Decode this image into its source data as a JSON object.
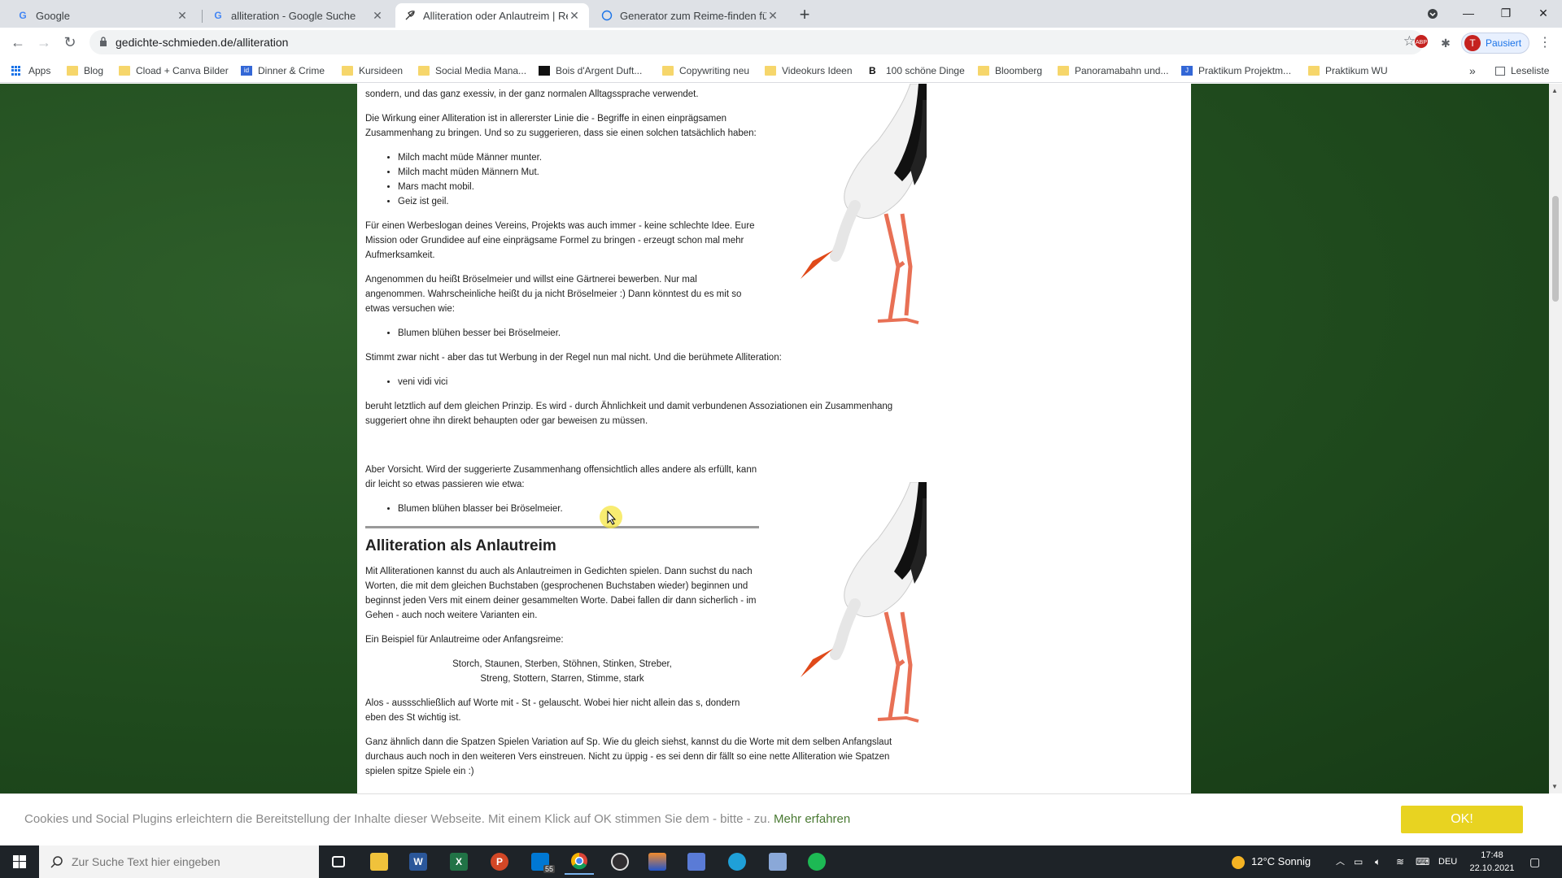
{
  "browser": {
    "tabs": [
      {
        "title": "Google",
        "favicon": "G"
      },
      {
        "title": "alliteration - Google Suche",
        "favicon": "G"
      },
      {
        "title": "Alliteration oder Anlautreim | Re",
        "favicon": "feather",
        "active": true
      },
      {
        "title": "Generator zum Reime-finden für",
        "favicon": "circle"
      }
    ],
    "url": "gedichte-schmieden.de/alliteration",
    "profile_label": "Pausiert",
    "profile_initial": "T",
    "extension_badge": "2"
  },
  "bookmarks": {
    "apps": "Apps",
    "items": [
      "Blog",
      "Cload + Canva Bilder",
      "Dinner & Crime",
      "Kursideen",
      "Social Media Mana...",
      "Bois d'Argent Duft...",
      "Copywriting neu",
      "Videokurs Ideen",
      "100 schöne Dinge",
      "Bloomberg",
      "Panoramabahn und...",
      "Praktikum Projektm...",
      "Praktikum WU"
    ],
    "more": "»",
    "reading_list": "Leseliste"
  },
  "article": {
    "p0": "sondern, und das ganz exessiv, in der ganz normalen Alltagssprache verwendet.",
    "p1": "Die Wirkung einer Alliteration ist in allererster Linie die - Begriffe in einen einprägsamen Zusammenhang zu bringen. Und so zu suggerieren, dass sie einen solchen tatsächlich haben:",
    "list1": [
      "Milch macht müde Männer munter.",
      "Milch macht müden Männern Mut.",
      "Mars macht mobil.",
      "Geiz ist geil."
    ],
    "p2": "Für einen Werbeslogan deines Vereins, Projekts was auch immer - keine schlechte Idee. Eure Mission oder Grundidee auf eine einprägsame Formel zu bringen - erzeugt schon mal mehr Aufmerksamkeit.",
    "p3": "Angenommen du heißt Bröselmeier und willst eine Gärtnerei bewerben. Nur mal angenommen. Wahrscheinliche heißt du ja nicht Bröselmeier :) Dann könntest du es mit so etwas versuchen wie:",
    "list2": [
      "Blumen blühen besser bei Bröselmeier."
    ],
    "p4": "Stimmt zwar nicht - aber das tut Werbung in der Regel nun mal nicht. Und die berühmete Alliteration:",
    "list3": [
      "veni vidi vici"
    ],
    "p5": "beruht letztlich auf dem gleichen Prinzip. Es wird - durch Ähnlichkeit und damit verbundenen Assoziationen ein Zusammenhang suggeriert ohne ihn direkt behaupten oder gar beweisen zu müssen.",
    "p6": "Aber Vorsicht. Wird der suggerierte Zusammenhang offensichtlich alles andere als erfüllt, kann dir leicht so etwas passieren wie etwa:",
    "list4": [
      "Blumen blühen blasser bei Bröselmeier."
    ],
    "heading": "Alliteration als Anlautreim",
    "p7": "Mit Alliterationen kannst du auch als Anlautreimen in Gedichten spielen. Dann suchst du nach Worten, die mit dem gleichen Buchstaben (gesprochenen Buchstaben wieder) beginnen und beginnst jeden Vers mit einem deiner gesammelten Worte. Dabei fallen dir dann sicherlich - im Gehen - auch noch weitere Varianten ein.",
    "p8": "Ein Beispiel für Anlautreime oder Anfangsreime:",
    "poem1": "Storch, Staunen, Sterben, Stöhnen, Stinken, Streber,",
    "poem2": "Streng, Stottern, Starren, Stimme, stark",
    "p9": "Alos - aussschließlich auf Worte mit - St - gelauscht. Wobei hier nicht allein das s, dondern eben des St wichtig ist.",
    "p10": "Ganz ähnlich dann die Spatzen Spielen Variation auf Sp. Wie du gleich siehst, kannst du die Worte mit dem selben Anfangslaut durchaus auch noch in den weiteren Vers einstreuen. Nicht zu üppig - es sei denn dir fällt so eine nette Alliteration wie Spatzen spielen spitze Spiele ein :)"
  },
  "cookie": {
    "message": "Cookies und Social Plugins erleichtern die Bereitstellung der Inhalte dieser Webseite. Mit einem Klick auf OK stimmen Sie dem - bitte - zu.",
    "link": "Mehr erfahren",
    "ok": "OK!"
  },
  "taskbar": {
    "search_placeholder": "Zur Suche Text hier eingeben",
    "mail_badge": "55",
    "weather": "12°C  Sonnig",
    "language": "DEU",
    "time": "17:48",
    "date": "22.10.2021"
  },
  "colors": {
    "page_bg": "#204d20",
    "accent_ok": "#e8d321",
    "link": "#4a7a33"
  }
}
